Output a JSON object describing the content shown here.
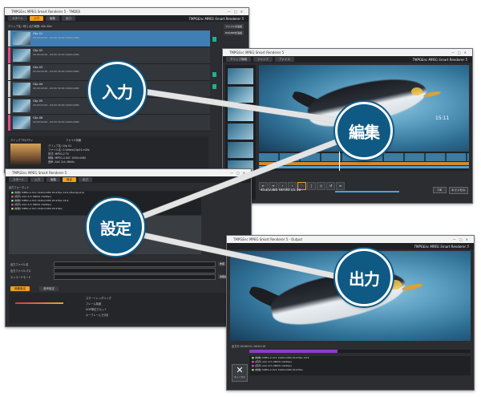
{
  "connector_color": "#e4e4e4",
  "badge_color": "#0f5a84",
  "badges": {
    "input": "入力",
    "edit": "編集",
    "settings": "設定",
    "output": "出力"
  },
  "win_input": {
    "title": "TMPGEnc MPEG Smart Renderer 5 - TMDES",
    "tabs": [
      "スタート",
      "入力",
      "編集",
      "出力"
    ],
    "brand": "TMPGEnc MPEG Smart Renderer 5",
    "header_line": "クリップ名: 3件 | 出力時間: 00h 00m",
    "clips": [
      {
        "name": "Clip 01",
        "info": "00:00:00:00 - 00:00:30:00  1920x1080"
      },
      {
        "name": "Clip 02",
        "info": "00:00:00:00 - 00:00:30:00  1920x1080"
      },
      {
        "name": "Clip 03",
        "info": "00:00:00:00 - 00:00:30:00  1920x1080"
      },
      {
        "name": "Clip 04",
        "info": "00:00:00:00 - 00:00:30:00  1920x1080"
      },
      {
        "name": "Clip 05",
        "info": "00:00:00:00 - 00:00:30:00  1920x1080"
      },
      {
        "name": "Clip 06",
        "info": "00:00:00:00 - 00:00:30:00  1920x1080"
      }
    ],
    "side_buttons": [
      "ファイルを追加",
      "DVD/BDを追加"
    ],
    "quick_property": "クイックプロパティ",
    "file_info": "ファイル情報",
    "file_lines": [
      "クリップ名: Clip 01",
      "ファイル名: C:\\Video\\Clip01.m2ts",
      "形式: MPEG-2 TS",
      "映像: MPEG-4 AVC 1920x1080",
      "音声: AAC 2ch 48kHz"
    ]
  },
  "win_edit": {
    "title": "TMPGEnc MPEG Smart Renderer 5",
    "brand": "TMPGEnc MPEG Smart Renderer 5",
    "toolbar_items": [
      "クリップ情報",
      "ジャンプ",
      "ファイル"
    ],
    "timecode": "453/2385 00:00:15.11",
    "overlay_time": "15:11",
    "ok": "OK",
    "cancel": "キャンセル"
  },
  "win_settings": {
    "title": "TMPGEnc MPEG Smart Renderer 5",
    "tabs": [
      "スタート",
      "入力",
      "編集",
      "設定",
      "出力"
    ],
    "panel_title": "出力フォーマット",
    "log_rows": [
      "[映像] MPEG-4 AVC 1920x1080 29.97fps 16:9 (Main@L4.0)",
      "[音声] AAC 2ch 48kHz 192kbps",
      "[映像] MPEG-4 AVC 1920x1080 29.97fps 16:9",
      "[音声] AAC 2ch 48kHz 192kbps",
      "[映像] MPEG-4 AVC 1920x1080 29.97fps"
    ],
    "form_labels": [
      "出力ファイル名",
      "出力ファイルパス",
      "エンコードモード"
    ],
    "lower_tabs": [
      "映像設定",
      "音声設定"
    ],
    "options": [
      "スマートレンダリング",
      "フレーム精度",
      "GOP単位でカット",
      "キーフレームで分割"
    ],
    "right_buttons": [
      "参照",
      "詳細設定"
    ]
  },
  "win_output": {
    "title": "TMPGEnc MPEG Smart Renderer 5 - Output",
    "brand": "TMPGEnc MPEG Smart Renderer 5",
    "progress_label": "出力中 00:00:15 / 00:01:19",
    "progress": 0.4,
    "log_rows": [
      "[映像] MPEG-4 AVC 1920x1080 29.97fps 16:9",
      "[音声] AAC 2ch 48kHz 192kbps",
      "[音声] AAC 2ch 48kHz 192kbps",
      "[映像] MPEG-4 AVC 1920x1080 29.97fps"
    ],
    "cancel": "キャンセル",
    "schedule": "スケジュール"
  }
}
